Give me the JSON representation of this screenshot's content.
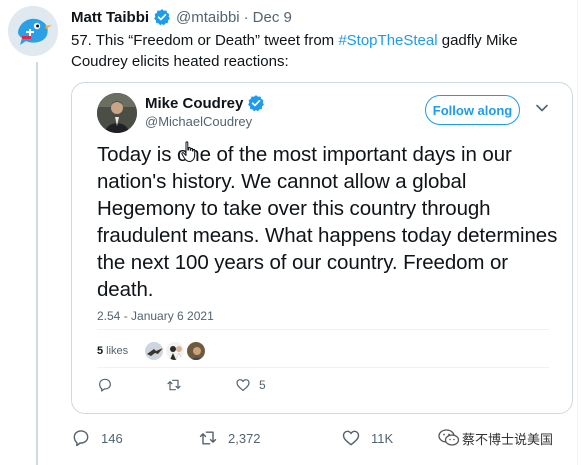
{
  "tweet": {
    "author_name": "Matt Taibbi",
    "handle": "@mtaibbi",
    "separator": "·",
    "date": "Dec 9",
    "text_before": "57. This “Freedom or Death” tweet from ",
    "hashtag": "#StopTheSteal",
    "text_after": " gadfly Mike Coudrey elicits heated reactions:",
    "avatar_icon": "bird-avatar-icon"
  },
  "quoted": {
    "author_name": "Mike Coudrey",
    "handle": "@MichaelCoudrey",
    "follow_label": "Follow along",
    "text": "Today is one of the most important days in our nation's history. We cannot allow a global Hegemony to take over this country through fraudulent means. What happens today determines the next 100 years of our country. Freedom or death.",
    "timestamp": "2.54 - January 6 2021",
    "likes_count": "5",
    "likes_label": "likes",
    "reply_count": "",
    "retweet_count": "",
    "like_count": "5"
  },
  "actions": {
    "reply_count": "146",
    "retweet_count": "2,372",
    "like_count": "11K"
  },
  "watermark": {
    "text": "蔡不博士说美国"
  },
  "colors": {
    "accent": "#1d9bf0",
    "text": "#0f1419",
    "muted": "#536471",
    "border": "#cfd9de"
  }
}
